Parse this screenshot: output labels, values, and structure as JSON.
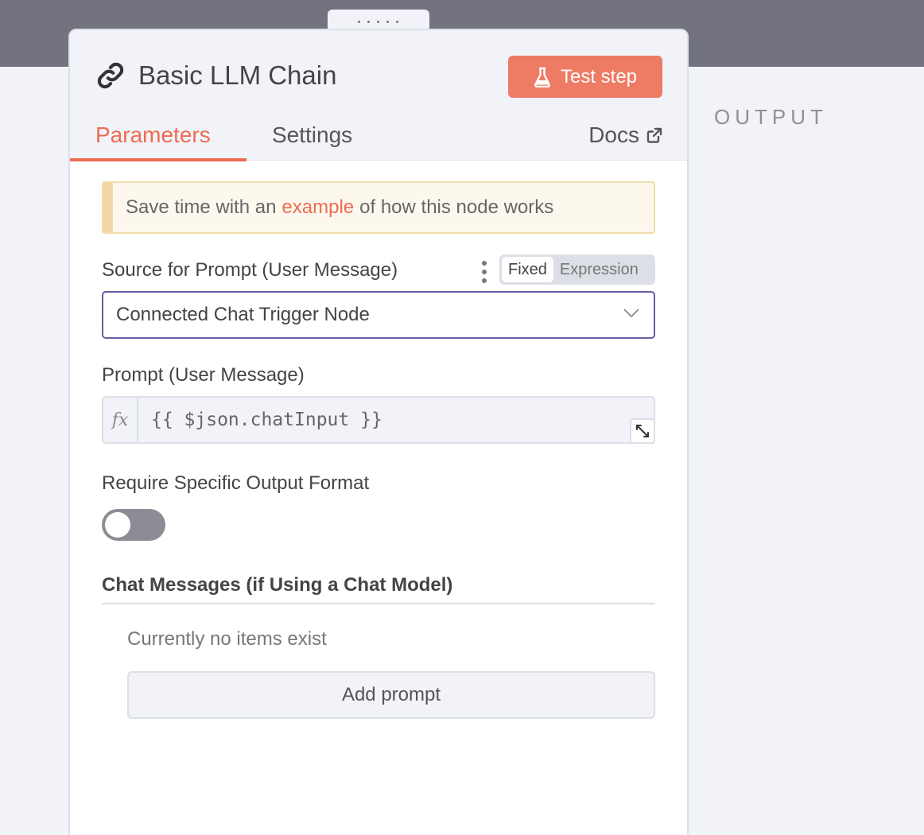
{
  "node": {
    "title": "Basic LLM Chain",
    "test_button": "Test step"
  },
  "tabs": {
    "parameters": "Parameters",
    "settings": "Settings",
    "docs": "Docs"
  },
  "callout": {
    "prefix": "Save time with an",
    "link": "example",
    "suffix": "of how this node works"
  },
  "source_field": {
    "label": "Source for Prompt (User Message)",
    "mode_fixed": "Fixed",
    "mode_expression": "Expression",
    "mode_selected": "Fixed",
    "value": "Connected Chat Trigger Node"
  },
  "prompt_field": {
    "label": "Prompt (User Message)",
    "fx": "fx",
    "value": "{{ $json.chatInput }}"
  },
  "output_format": {
    "label": "Require Specific Output Format",
    "enabled": false
  },
  "chat_messages": {
    "title": "Chat Messages (if Using a Chat Model)",
    "empty_text": "Currently no items exist",
    "add_button": "Add prompt"
  },
  "output_panel": {
    "label": "OUTPUT"
  },
  "colors": {
    "accent": "#ee6b52",
    "button": "#ee7b64",
    "select_border": "#6b5ba6"
  }
}
